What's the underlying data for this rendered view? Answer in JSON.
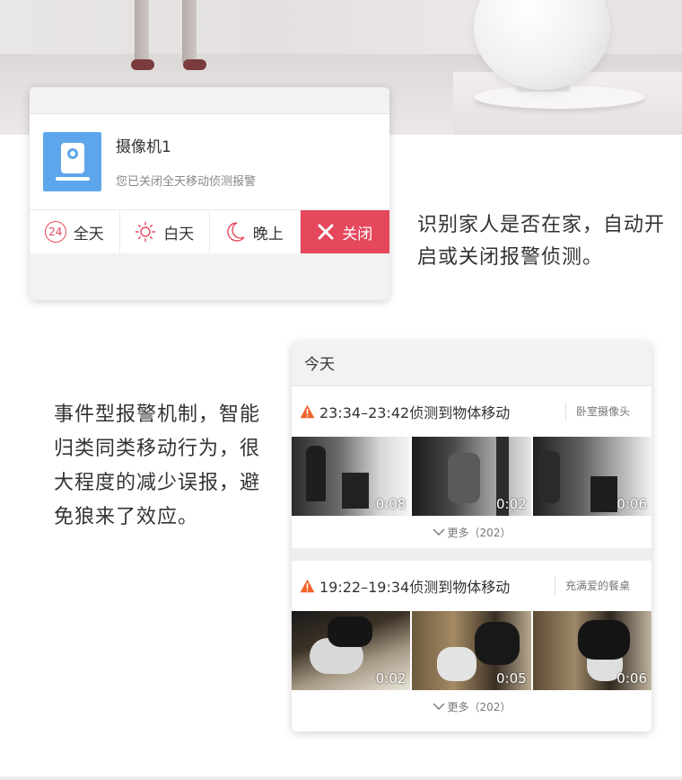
{
  "alarm_card": {
    "camera_name": "摄像机1",
    "status_text": "您已关闭全天移动侦测报警",
    "modes": [
      {
        "label": "全天",
        "badge": "24"
      },
      {
        "label": "白天"
      },
      {
        "label": "晚上"
      },
      {
        "label": "关闭",
        "active": true
      }
    ],
    "accent_color": "#e5475d",
    "tile_color": "#5ea6ec"
  },
  "caption_family": "识别家人是否在家，自动开启或关闭报警侦测。",
  "caption_smart": "事件型报警机制，智能归类同类移动行为，很大程度的减少误报，避免狼来了效应。",
  "events_card": {
    "header": "今天",
    "events": [
      {
        "title": "23:34–23:42侦测到物体移动",
        "location": "卧室摄像头",
        "clips": [
          "0:08",
          "0:02",
          "0:06"
        ],
        "more": "更多（202）"
      },
      {
        "title": "19:22–19:34侦测到物体移动",
        "location": "充满爱的餐桌",
        "clips": [
          "0:02",
          "0:05",
          "0:06"
        ],
        "more": "更多（202）"
      }
    ],
    "warning_color": "#f2632a"
  }
}
